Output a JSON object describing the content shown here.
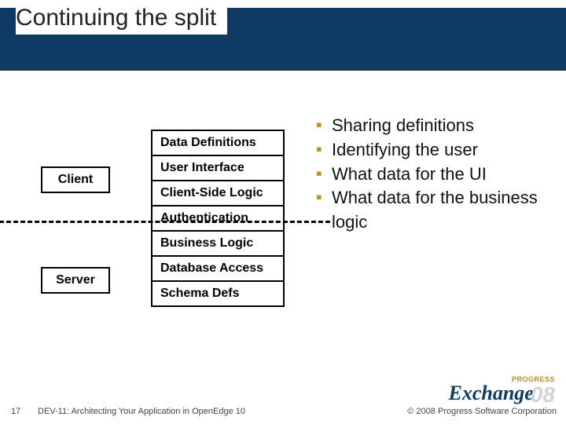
{
  "title": "Continuing the split",
  "left": {
    "client": "Client",
    "server": "Server",
    "stack": [
      "Data Definitions",
      "User Interface",
      "Client-Side Logic",
      "Authentication",
      "Business Logic",
      "Database Access",
      "Schema Defs"
    ]
  },
  "bullets": [
    "Sharing definitions",
    "Identifying the user",
    "What data for the UI",
    "What data for the business logic"
  ],
  "footer": {
    "page": "17",
    "left": "DEV-11: Architecting Your Application in OpenEdge 10",
    "right": "© 2008 Progress Software Corporation"
  },
  "logo": {
    "top": "PROGRESS",
    "main": "Exchange",
    "year": "08"
  }
}
